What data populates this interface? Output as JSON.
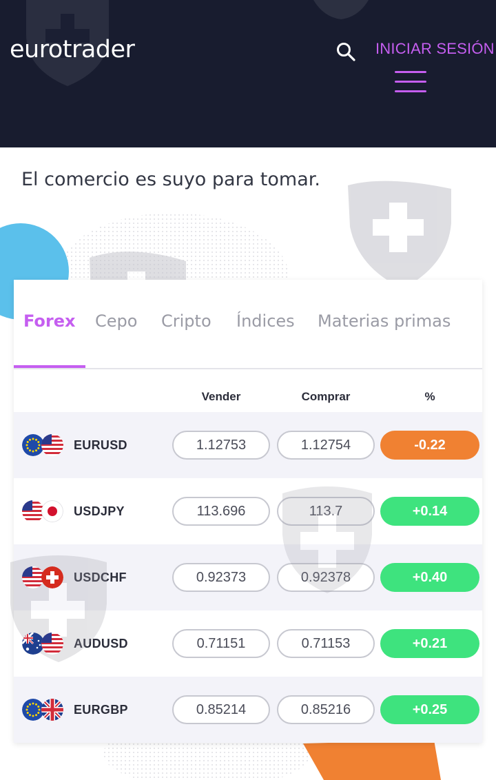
{
  "header": {
    "logo": "eurotrader",
    "login_label": "INICIAR SESIÓN",
    "search_icon": "search-icon",
    "menu_icon": "hamburger-menu-icon"
  },
  "tagline": "El comercio es suyo para tomar.",
  "tabs": [
    {
      "label": "Forex",
      "active": true
    },
    {
      "label": "Cepo",
      "active": false
    },
    {
      "label": "Cripto",
      "active": false
    },
    {
      "label": "Índices",
      "active": false
    },
    {
      "label": "Materias primas",
      "active": false
    }
  ],
  "table": {
    "columns": {
      "sell": "Vender",
      "buy": "Comprar",
      "percent": "%"
    },
    "rows": [
      {
        "pair": "EURUSD",
        "flags": [
          "eu-flag",
          "us-flag"
        ],
        "sell": "1.12753",
        "buy": "1.12754",
        "change": "-0.22",
        "direction": "down"
      },
      {
        "pair": "USDJPY",
        "flags": [
          "us-flag",
          "jp-flag"
        ],
        "sell": "113.696",
        "buy": "113.7",
        "change": "+0.14",
        "direction": "up"
      },
      {
        "pair": "USDCHF",
        "flags": [
          "us-flag",
          "ch-flag"
        ],
        "sell": "0.92373",
        "buy": "0.92378",
        "change": "+0.40",
        "direction": "up"
      },
      {
        "pair": "AUDUSD",
        "flags": [
          "au-flag",
          "us-flag"
        ],
        "sell": "0.71151",
        "buy": "0.71153",
        "change": "+0.21",
        "direction": "up"
      },
      {
        "pair": "EURGBP",
        "flags": [
          "eu-flag",
          "gb-flag"
        ],
        "sell": "0.85214",
        "buy": "0.85216",
        "change": "+0.25",
        "direction": "up"
      }
    ]
  },
  "colors": {
    "header_bg": "#181c2f",
    "accent": "#c55ef0",
    "negative": "#f08132",
    "positive": "#3ee37e"
  }
}
